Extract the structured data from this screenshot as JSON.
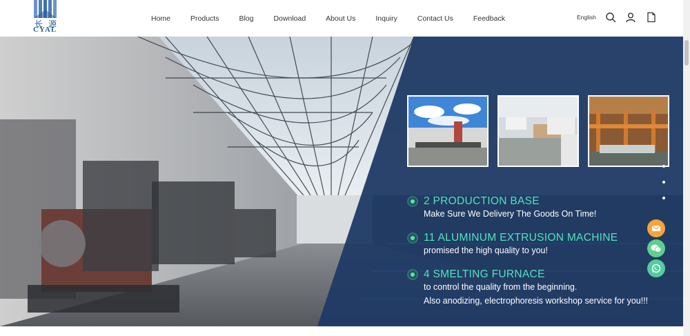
{
  "header": {
    "logo": {
      "cn_text": "长 源",
      "en_text": "CYAL",
      "brand_color": "#3d6fb3"
    },
    "nav": [
      {
        "label": "Home"
      },
      {
        "label": "Products"
      },
      {
        "label": "Blog"
      },
      {
        "label": "Download"
      },
      {
        "label": "About Us"
      },
      {
        "label": "Inquiry"
      },
      {
        "label": "Contact Us"
      },
      {
        "label": "Feedback"
      }
    ],
    "language": "English",
    "icons": [
      "search-icon",
      "user-icon",
      "cart-icon"
    ]
  },
  "hero": {
    "photos": [
      {
        "name": "factory-exterior-photo"
      },
      {
        "name": "factory-aerial-photo"
      },
      {
        "name": "extrusion-line-photo"
      }
    ],
    "features": [
      {
        "title": "2 PRODUCTION BASE",
        "subtitle": "Make Sure We Delivery The Goods On Time!"
      },
      {
        "title": "11 ALUMINUM EXTRUSION MACHINE",
        "subtitle": "promised the high quality to you!"
      },
      {
        "title": "4 SMELTING FURNACE",
        "subtitle": "to control the quality from the beginning."
      }
    ],
    "extra_line": "Also anodizing, electrophoresis workshop service for you!!!",
    "colors": {
      "panel": "#1f3a64",
      "accent": "#52e3bd"
    }
  },
  "floating_buttons": [
    {
      "name": "email-icon",
      "color": "#f4a53c"
    },
    {
      "name": "wechat-icon",
      "color": "#5fcf8e"
    },
    {
      "name": "whatsapp-icon",
      "color": "#55cba0"
    }
  ]
}
